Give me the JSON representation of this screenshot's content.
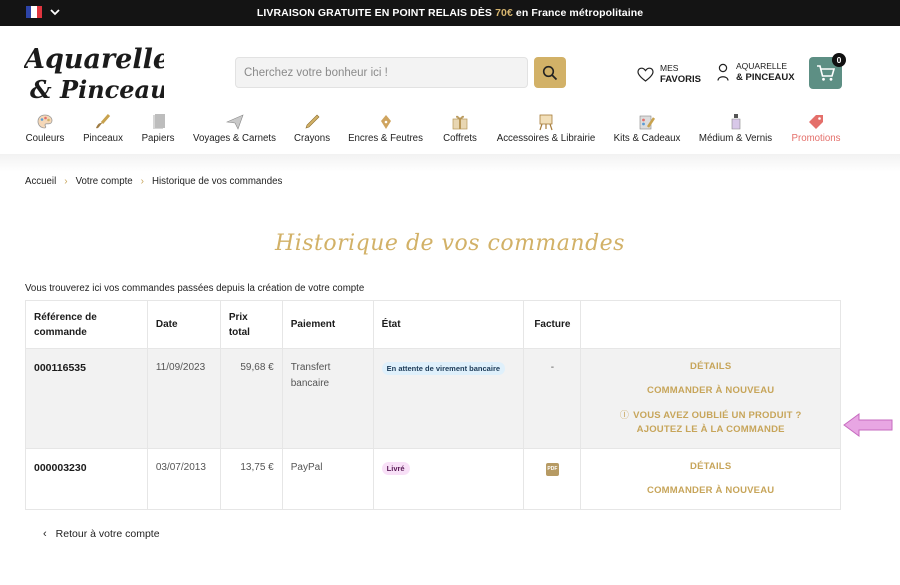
{
  "topbar": {
    "promo_main": "LIVRAISON GRATUITE EN POINT RELAIS DÈS ",
    "promo_price": "70€",
    "promo_rest": " en France métropolitaine",
    "lang_icon": "chevron-down-icon"
  },
  "brand": {
    "line1": "Aquarelle",
    "line2": "& Pinceaux",
    "color": "#1b1b1b"
  },
  "search": {
    "placeholder": "Cherchez votre bonheur ici !",
    "value": ""
  },
  "header": {
    "favorites_line1": "MES",
    "favorites_line2": "FAVORIS",
    "account_line1": "AQUARELLE",
    "account_line2": "& PINCEAUX",
    "cart_count": "0"
  },
  "nav": [
    {
      "label": "Couleurs",
      "icon": "palette-icon"
    },
    {
      "label": "Pinceaux",
      "icon": "brush-icon"
    },
    {
      "label": "Papiers",
      "icon": "paper-icon"
    },
    {
      "label": "Voyages & Carnets",
      "icon": "paper-plane-icon"
    },
    {
      "label": "Crayons",
      "icon": "pencil-icon"
    },
    {
      "label": "Encres & Feutres",
      "icon": "pen-nib-icon"
    },
    {
      "label": "Coffrets",
      "icon": "gift-box-icon"
    },
    {
      "label": "Accessoires & Librairie",
      "icon": "easel-icon"
    },
    {
      "label": "Kits & Cadeaux",
      "icon": "kit-icon"
    },
    {
      "label": "Médium & Vernis",
      "icon": "bottle-icon"
    },
    {
      "label": "Promotions",
      "icon": "tag-icon"
    }
  ],
  "breadcrumb": [
    "Accueil",
    "Votre compte",
    "Historique de vos commandes"
  ],
  "page": {
    "title": "Historique de vos commandes",
    "intro": "Vous trouverez ici vos commandes passées depuis la création de votre compte"
  },
  "table": {
    "headers": {
      "ref_1": "Référence de",
      "ref_2": "commande",
      "date": "Date",
      "price_1": "Prix",
      "price_2": "total",
      "payment": "Paiement",
      "state": "État",
      "invoice": "Facture"
    },
    "rows": [
      {
        "ref": "000116535",
        "date": "11/09/2023",
        "price": "59,68 €",
        "payment_1": "Transfert",
        "payment_2": "bancaire",
        "state": "En attente de virement bancaire",
        "invoice": "-",
        "details": "DÉTAILS",
        "reorder": "COMMANDER À NOUVEAU",
        "forgot": "VOUS AVEZ OUBLIÉ UN PRODUIT ? AJOUTEZ LE À LA COMMANDE"
      },
      {
        "ref": "000003230",
        "date": "03/07/2013",
        "price": "13,75 €",
        "payment_1": "PayPal",
        "state": "Livré",
        "invoice_icon": "pdf-icon",
        "invoice_icon_text": "PDF",
        "details": "DÉTAILS",
        "reorder": "COMMANDER À NOUVEAU"
      }
    ]
  },
  "back_link": "Retour à votre compte",
  "colors": {
    "gold": "#d2b167",
    "cart": "#5d8f84",
    "promo": "#e46f6a",
    "badge_wait": "#dff0fb",
    "badge_done": "#f8e0f7",
    "arrow": "#d985d3"
  }
}
